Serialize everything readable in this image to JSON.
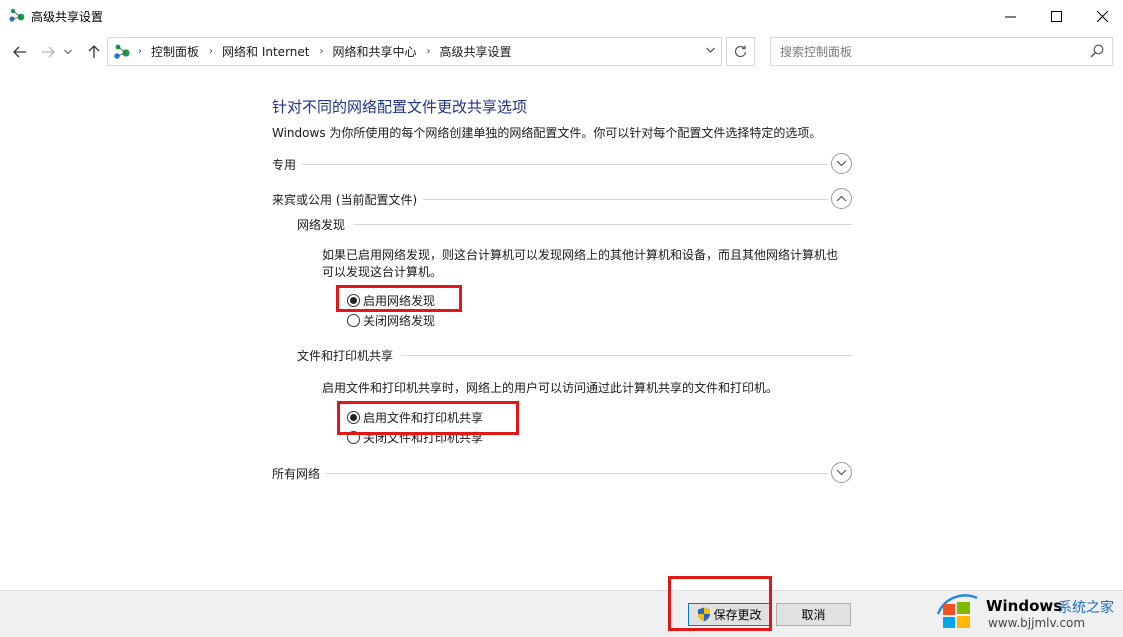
{
  "window": {
    "title": "高级共享设置",
    "controls": {
      "minimize": "—",
      "maximize": "☐",
      "close": "✕"
    }
  },
  "nav": {
    "breadcrumbs": [
      "控制面板",
      "网络和 Internet",
      "网络和共享中心",
      "高级共享设置"
    ],
    "search_placeholder": "搜索控制面板"
  },
  "main": {
    "heading": "针对不同的网络配置文件更改共享选项",
    "description": "Windows 为你所使用的每个网络创建单独的网络配置文件。你可以针对每个配置文件选择特定的选项。",
    "profiles": [
      {
        "label": "专用",
        "expanded": false
      },
      {
        "label": "来宾或公用 (当前配置文件)",
        "expanded": true
      },
      {
        "label": "所有网络",
        "expanded": false
      }
    ],
    "network_discovery": {
      "title": "网络发现",
      "description": "如果已启用网络发现，则这台计算机可以发现网络上的其他计算机和设备，而且其他网络计算机也可以发现这台计算机。",
      "options": [
        {
          "label": "启用网络发现",
          "selected": true
        },
        {
          "label": "关闭网络发现",
          "selected": false
        }
      ]
    },
    "file_sharing": {
      "title": "文件和打印机共享",
      "description": "启用文件和打印机共享时，网络上的用户可以访问通过此计算机共享的文件和打印机。",
      "options": [
        {
          "label": "启用文件和打印机共享",
          "selected": true
        },
        {
          "label": "关闭文件和打印机共享",
          "selected": false
        }
      ]
    }
  },
  "footer": {
    "save_label": "保存更改",
    "cancel_label": "取消"
  },
  "watermark": {
    "brand": "Windows",
    "brand_suffix": "系统之家",
    "url": "www.bjjmlv.com"
  },
  "colors": {
    "heading": "#1e3287",
    "highlight": "#e11818",
    "accent": "#0078d7"
  }
}
